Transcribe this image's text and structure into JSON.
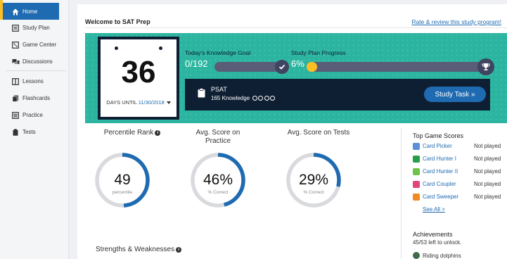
{
  "sidebar": {
    "items": [
      {
        "label": "Home",
        "icon": "home-icon",
        "active": true
      },
      {
        "label": "Study Plan",
        "icon": "study-plan-icon"
      },
      {
        "label": "Game Center",
        "icon": "game-center-icon"
      },
      {
        "label": "Discussions",
        "icon": "discussions-icon"
      },
      {
        "label": "Lessons",
        "icon": "lessons-icon"
      },
      {
        "label": "Flashcards",
        "icon": "flashcards-icon"
      },
      {
        "label": "Practice",
        "icon": "practice-icon"
      },
      {
        "label": "Tests",
        "icon": "tests-icon"
      }
    ]
  },
  "header": {
    "title": "Welcome to SAT Prep",
    "rate_link": "Rate & review this study program!"
  },
  "countdown": {
    "days": "36",
    "label": "DAYS UNTIL",
    "date": "11/30/2018"
  },
  "knowledge_goal": {
    "label": "Today's Knowledge Goal",
    "value": "0/192",
    "progress": 0
  },
  "study_plan": {
    "label": "Study Plan Progress",
    "value": "6%",
    "progress": 0.06
  },
  "task": {
    "title": "PSAT",
    "subtitle": "165 Knowledge",
    "button": "Study Task »"
  },
  "stats": [
    {
      "title": "Percentile Rank",
      "value": "49",
      "sub": "percentile",
      "fraction": 0.49,
      "info": true
    },
    {
      "title": "Avg. Score on Practice",
      "value": "46%",
      "sub": "% Correct",
      "fraction": 0.46,
      "info": false
    },
    {
      "title": "Avg. Score on Tests",
      "value": "29%",
      "sub": "% Correct",
      "fraction": 0.29,
      "info": false
    }
  ],
  "strengths_title": "Strengths & Weaknesses",
  "top_games": {
    "title": "Top Game Scores",
    "games": [
      {
        "name": "Card Picker",
        "status": "Not played",
        "color": "#5b8fd6"
      },
      {
        "name": "Card Hunter I",
        "status": "Not played",
        "color": "#2a9d4b"
      },
      {
        "name": "Card Hunter II",
        "status": "Not played",
        "color": "#6cc24a"
      },
      {
        "name": "Card Coupler",
        "status": "Not played",
        "color": "#e0457b"
      },
      {
        "name": "Card Sweeper",
        "status": "Not played",
        "color": "#f08a24"
      }
    ],
    "see_all": "See All >"
  },
  "achievements": {
    "title": "Achievements",
    "sub": "45/53 left to unlock.",
    "item": "Riding dolphins"
  },
  "colors": {
    "primary": "#1f6bb2",
    "teal": "#2bb5a0",
    "navy": "#0f1f33",
    "accent": "#fbbf24"
  }
}
